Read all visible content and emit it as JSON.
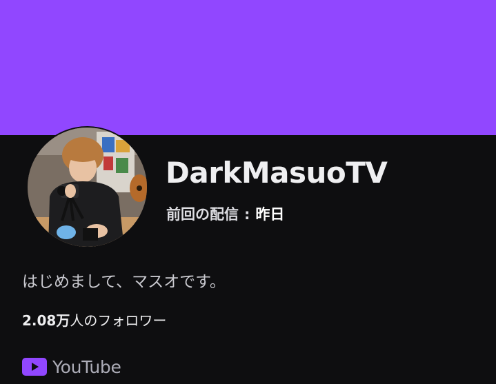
{
  "colors": {
    "banner": "#9147ff",
    "background": "#0e0e10",
    "accent": "#9147ff"
  },
  "channel": {
    "name": "DarkMasuoTV",
    "last_stream_label": "前回の配信",
    "last_stream_separator": ":",
    "last_stream_value": "昨日",
    "bio": "はじめまして、マスオです。",
    "followers_count": "2.08万",
    "followers_suffix": "人のフォロワー"
  },
  "social_links": [
    {
      "label": "YouTube",
      "icon": "youtube-icon"
    }
  ]
}
